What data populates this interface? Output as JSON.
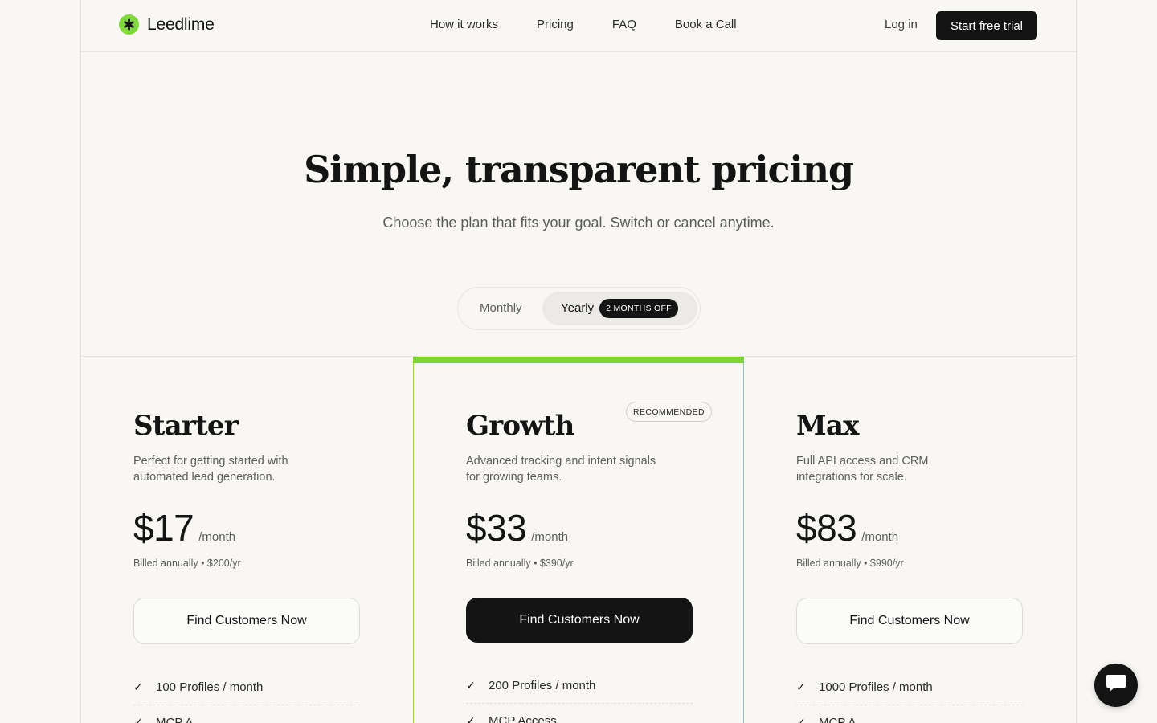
{
  "brand": {
    "name": "Leedlime",
    "accent": "#7fd93a"
  },
  "nav": {
    "items": [
      {
        "label": "How it works"
      },
      {
        "label": "Pricing"
      },
      {
        "label": "FAQ"
      },
      {
        "label": "Book a Call"
      }
    ],
    "login": "Log in",
    "cta": "Start free trial"
  },
  "hero": {
    "title": "Simple, transparent pricing",
    "subtitle": "Choose the plan that fits your goal. Switch or cancel anytime."
  },
  "billing_toggle": {
    "monthly": "Monthly",
    "yearly": "Yearly",
    "badge": "2 MONTHS OFF",
    "selected": "Yearly"
  },
  "plans": [
    {
      "name": "Starter",
      "description": "Perfect for getting started with automated lead generation.",
      "price": "$17",
      "period": "/month",
      "billed": "Billed annually • $200/yr",
      "button": "Find Customers Now",
      "features": [
        "100 Profiles / month",
        "MCP A..."
      ]
    },
    {
      "name": "Growth",
      "badge": "RECOMMENDED",
      "description": "Advanced tracking and intent signals for growing teams.",
      "price": "$33",
      "period": "/month",
      "billed": "Billed annually • $390/yr",
      "button": "Find Customers Now",
      "features": [
        "200 Profiles / month",
        "MCP Access"
      ]
    },
    {
      "name": "Max",
      "description": "Full API access and CRM integrations for scale.",
      "price": "$83",
      "period": "/month",
      "billed": "Billed annually • $990/yr",
      "button": "Find Customers Now",
      "features": [
        "1000 Profiles / month",
        "MCP A..."
      ]
    }
  ],
  "icons": {
    "logo": "asterisk-icon",
    "check": "check-icon",
    "chat": "chat-icon"
  }
}
